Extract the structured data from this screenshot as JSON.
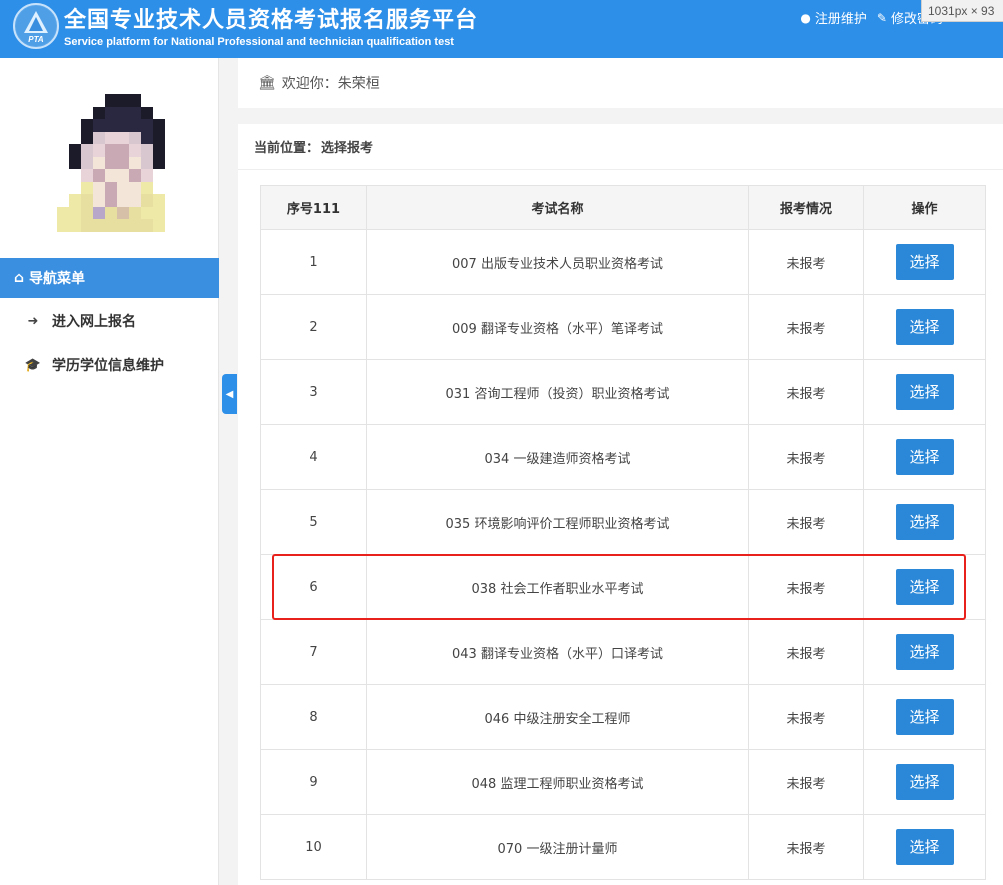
{
  "header": {
    "title_cn": "全国专业技术人员资格考试报名服务平台",
    "title_en": "Service platform for National Professional and technician qualification test",
    "logo_text": "PTA",
    "links": [
      {
        "label": "注册维护",
        "icon": "info-circle-icon"
      },
      {
        "label": "修改密码",
        "icon": "edit-icon"
      }
    ],
    "size_badge": "1031px × 93"
  },
  "sidebar": {
    "nav_header": "导航菜单",
    "nav_header_icon": "home-icon",
    "items": [
      {
        "label": "进入网上报名",
        "icon": "sign-in-icon"
      },
      {
        "label": "学历学位信息维护",
        "icon": "graduation-cap-icon"
      }
    ]
  },
  "welcome": {
    "icon": "bank-icon",
    "text": "欢迎你：朱荣桓"
  },
  "breadcrumb": {
    "label": "当前位置：",
    "current": "选择报考"
  },
  "table": {
    "headers": [
      "序号111",
      "考试名称",
      "报考情况",
      "操作"
    ],
    "rows": [
      {
        "no": "1",
        "name": "007 出版专业技术人员职业资格考试",
        "status": "未报考",
        "action": "选择"
      },
      {
        "no": "2",
        "name": "009 翻译专业资格（水平）笔译考试",
        "status": "未报考",
        "action": "选择"
      },
      {
        "no": "3",
        "name": "031 咨询工程师（投资）职业资格考试",
        "status": "未报考",
        "action": "选择"
      },
      {
        "no": "4",
        "name": "034 一级建造师资格考试",
        "status": "未报考",
        "action": "选择"
      },
      {
        "no": "5",
        "name": "035 环境影响评价工程师职业资格考试",
        "status": "未报考",
        "action": "选择"
      },
      {
        "no": "6",
        "name": "038 社会工作者职业水平考试",
        "status": "未报考",
        "action": "选择"
      },
      {
        "no": "7",
        "name": "043 翻译专业资格（水平）口译考试",
        "status": "未报考",
        "action": "选择"
      },
      {
        "no": "8",
        "name": "046 中级注册安全工程师",
        "status": "未报考",
        "action": "选择"
      },
      {
        "no": "9",
        "name": "048 监理工程师职业资格考试",
        "status": "未报考",
        "action": "选择"
      },
      {
        "no": "10",
        "name": "070 一级注册计量师",
        "status": "未报考",
        "action": "选择"
      }
    ]
  },
  "colors": {
    "header_bg": "#2e8fe8",
    "nav_active": "#3b8fe0",
    "button": "#2b88d8",
    "highlight": "#e8211c"
  }
}
